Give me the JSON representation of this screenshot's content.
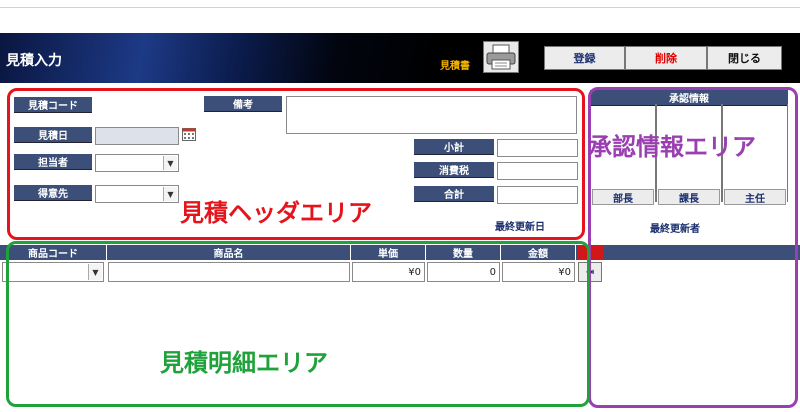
{
  "header": {
    "title": "見積入力",
    "estimate_doc_label": "見積書",
    "register_label": "登録",
    "delete_label": "削除",
    "close_label": "閉じる"
  },
  "form": {
    "estimate_code_label": "見積コード",
    "estimate_date_label": "見積日",
    "staff_label": "担当者",
    "customer_label": "得意先",
    "remarks_label": "備考",
    "subtotal_label": "小計",
    "tax_label": "消費税",
    "total_label": "合計",
    "last_updated_label": "最終更新日"
  },
  "approval": {
    "title": "承認情報",
    "positions": [
      "部長",
      "課長",
      "主任"
    ],
    "last_updater_label": "最終更新者"
  },
  "detail": {
    "columns": [
      "商品コード",
      "商品名",
      "単価",
      "数量",
      "金額"
    ],
    "row": {
      "unit_price": "¥0",
      "quantity": "0",
      "amount": "¥0"
    }
  },
  "annotations": {
    "header_area": "見積ヘッダエリア",
    "approval_area": "承認情報エリア",
    "detail_area": "見積明細エリア",
    "colors": {
      "header_area": "#e5141c",
      "approval_area": "#9a3fb1",
      "detail_area": "#1fa23a"
    }
  },
  "colors": {
    "label_bg": "#3b4f79",
    "delete_text": "#e00000",
    "estimate_doc_text": "#f0b000"
  }
}
